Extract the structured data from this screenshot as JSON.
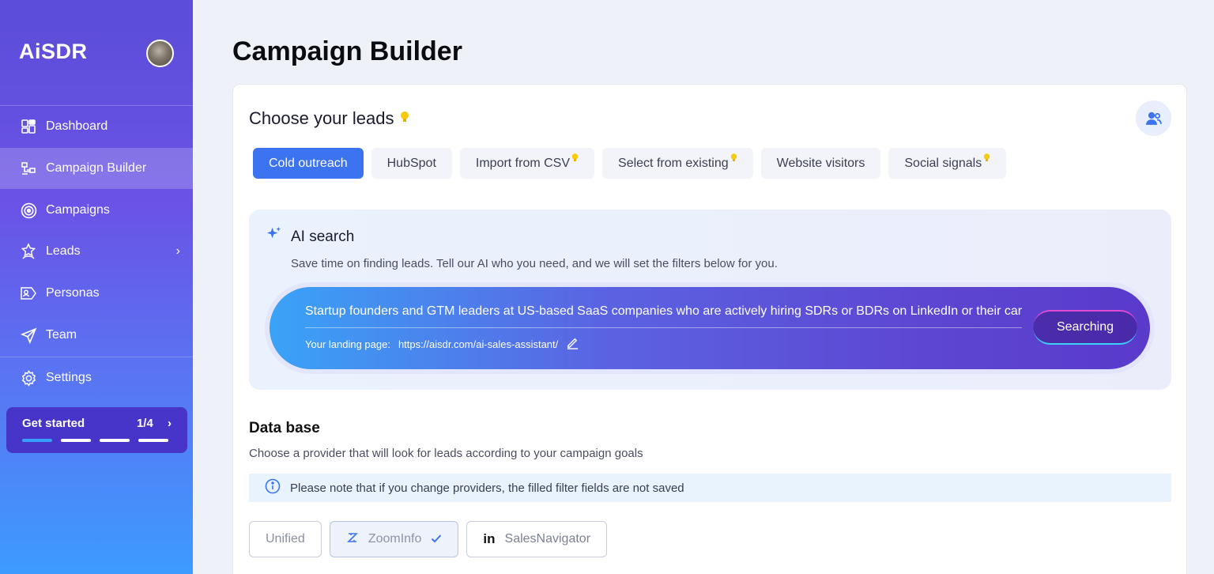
{
  "sidebar": {
    "brand": "AiSDR",
    "nav": [
      {
        "label": "Dashboard",
        "icon": "dashboard-icon"
      },
      {
        "label": "Campaign Builder",
        "icon": "campaign-builder-icon",
        "active": true
      },
      {
        "label": "Campaigns",
        "icon": "target-icon"
      },
      {
        "label": "Leads",
        "icon": "star-person-icon",
        "has_submenu": true
      },
      {
        "label": "Personas",
        "icon": "persona-card-icon"
      },
      {
        "label": "Team",
        "icon": "send-icon"
      },
      {
        "label": "Settings",
        "icon": "gear-icon"
      }
    ],
    "get_started": {
      "label": "Get started",
      "progress": "1/4",
      "steps_total": 4,
      "steps_done": 1
    }
  },
  "page": {
    "title": "Campaign Builder"
  },
  "leads": {
    "title": "Choose your leads",
    "tabs": [
      {
        "label": "Cold outreach",
        "active": true,
        "hint": false
      },
      {
        "label": "HubSpot",
        "hint": false
      },
      {
        "label": "Import from CSV",
        "hint": true
      },
      {
        "label": "Select from existing",
        "hint": true
      },
      {
        "label": "Website visitors",
        "hint": false
      },
      {
        "label": "Social signals",
        "hint": true
      }
    ]
  },
  "ai_search": {
    "title": "AI search",
    "description": "Save time on finding leads. Tell our AI who you need, and we will set the filters below for you.",
    "query": "Startup founders and GTM leaders at US-based SaaS companies who are actively hiring SDRs or BDRs on LinkedIn or their careers",
    "landing_label": "Your landing page:",
    "landing_url": "https://aisdr.com/ai-sales-assistant/",
    "button_label": "Searching"
  },
  "database": {
    "title": "Data base",
    "description": "Choose a provider that will look for leads according to your campaign goals",
    "notice": "Please note that if you change providers, the filled filter fields are not saved",
    "providers": [
      {
        "label": "Unified"
      },
      {
        "label": "ZoomInfo",
        "selected": true
      },
      {
        "label": "SalesNavigator",
        "logo": "in"
      }
    ]
  },
  "colors": {
    "accent": "#3b73f0",
    "hint": "#f5cc0e"
  }
}
